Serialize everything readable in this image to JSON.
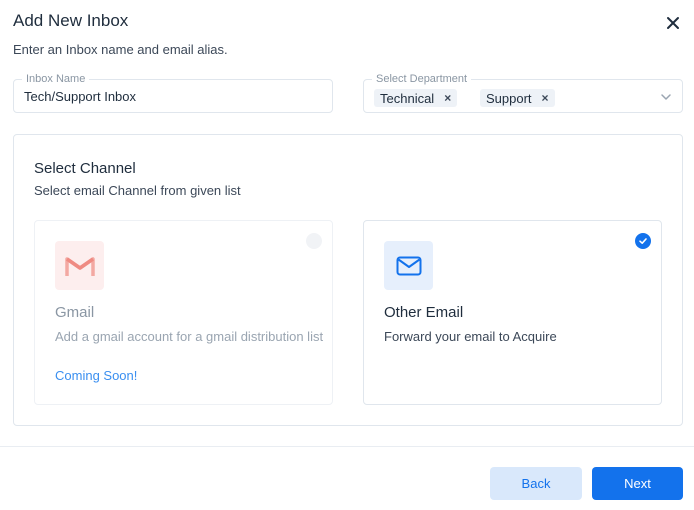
{
  "dialog": {
    "title": "Add New Inbox",
    "subtitle": "Enter an Inbox name and email alias.",
    "close_icon": "close-icon"
  },
  "inbox_name": {
    "label": "Inbox Name",
    "value": "Tech/Support Inbox"
  },
  "department": {
    "label": "Select Department",
    "chips": [
      {
        "label": "Technical",
        "remove": "×"
      },
      {
        "label": "Support",
        "remove": "×"
      }
    ],
    "dropdown_icon": "chevron-down-icon"
  },
  "channel": {
    "title": "Select Channel",
    "subtitle": "Select email Channel from given list",
    "options": [
      {
        "name": "Gmail",
        "description": "Add a gmail account for a gmail distribution list",
        "note": "Coming Soon!",
        "icon": "gmail-icon",
        "selected": false,
        "disabled": true
      },
      {
        "name": "Other Email",
        "description": "Forward your email to Acquire",
        "icon": "mail-icon",
        "selected": true,
        "disabled": false
      }
    ]
  },
  "footer": {
    "back_label": "Back",
    "next_label": "Next"
  },
  "colors": {
    "primary": "#1372ec",
    "primary_light": "#d9e8fb",
    "gmail_red": "#ea4335",
    "link": "#3a8ff0"
  }
}
